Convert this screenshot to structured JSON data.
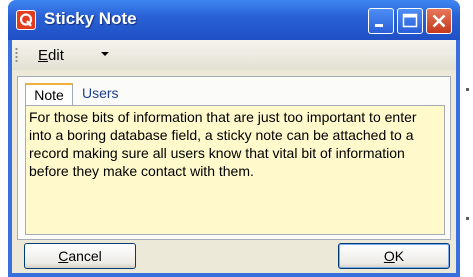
{
  "window": {
    "title": "Sticky Note",
    "app_icon": "app-q-icon",
    "controls": [
      "minimize-icon",
      "maximize-icon",
      "close-icon"
    ]
  },
  "menubar": {
    "edit_label_underlined": "E",
    "edit_label_rest": "dit"
  },
  "tabs": [
    {
      "label": "Note",
      "active": true
    },
    {
      "label": "Users",
      "active": false
    }
  ],
  "note": {
    "text": "For those bits of information that are just too important to enter into a boring database field, a sticky note can be attached to a record making sure all users know that vital bit of information before they make contact with them."
  },
  "buttons": {
    "cancel_underlined": "C",
    "cancel_rest": "ancel",
    "ok_underlined": "O",
    "ok_rest": "K"
  },
  "colors": {
    "title_bar": "#2a62d6",
    "note_background": "#fff9cc",
    "close_button": "#c4391c",
    "active_tab_accent": "#f0b040"
  }
}
